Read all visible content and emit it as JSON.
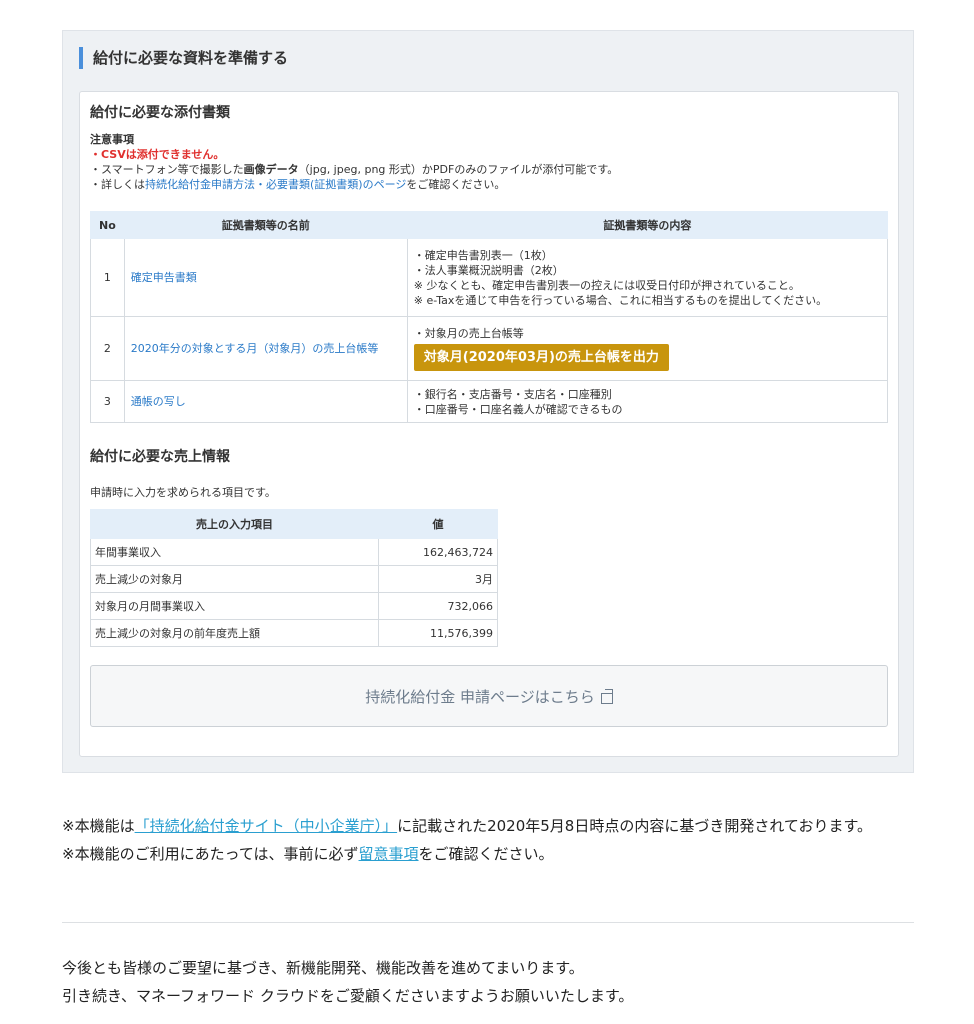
{
  "section": {
    "heading": "給付に必要な資料を準備する"
  },
  "attachments": {
    "title": "給付に必要な添付書類",
    "notes_title": "注意事項",
    "note_csv": "・CSVは添付できません。",
    "note_image_pre": "・スマートフォン等で撮影した",
    "note_image_bold": "画像データ",
    "note_image_post": "（jpg, jpeg, png 形式）かPDFのみのファイルが添付可能です。",
    "note_detail_pre": "・詳しくは",
    "note_detail_link": "持続化給付金申請方法・必要書類(証拠書類)のページ",
    "note_detail_post": "をご確認ください。",
    "table": {
      "headers": [
        "No",
        "証拠書類等の名前",
        "証拠書類等の内容"
      ],
      "rows": [
        {
          "no": "1",
          "name": "確定申告書類",
          "details": [
            "・確定申告書別表一（1枚）",
            "・法人事業概況説明書（2枚）",
            "※ 少なくとも、確定申告書別表一の控えには収受日付印が押されていること。",
            "※ e-Taxを通じて申告を行っている場合、これに相当するものを提出してください。"
          ]
        },
        {
          "no": "2",
          "name": "2020年分の対象とする月（対象月）の売上台帳等",
          "details": [
            "・対象月の売上台帳等"
          ],
          "button": "対象月(2020年03月)の売上台帳を出力"
        },
        {
          "no": "3",
          "name": "通帳の写し",
          "details": [
            "・銀行名・支店番号・支店名・口座種別",
            "・口座番号・口座名義人が確認できるもの"
          ]
        }
      ]
    }
  },
  "sales": {
    "title": "給付に必要な売上情報",
    "note": "申請時に入力を求められる項目です。",
    "headers": [
      "売上の入力項目",
      "値"
    ],
    "rows": [
      {
        "label": "年間事業収入",
        "value": "162,463,724"
      },
      {
        "label": "売上減少の対象月",
        "value": "3月"
      },
      {
        "label": "対象月の月間事業収入",
        "value": "732,066"
      },
      {
        "label": "売上減少の対象月の前年度売上額",
        "value": "11,576,399"
      }
    ]
  },
  "apply_button": "持続化給付金 申請ページはこちら",
  "footer": {
    "line1_pre": "※本機能は",
    "line1_link": "「持続化給付金サイト（中小企業庁）」",
    "line1_post": "に記載された2020年5月8日時点の内容に基づき開発されております。",
    "line2_pre": "※本機能のご利用にあたっては、事前に必ず",
    "line2_link": "留意事項",
    "line2_post": "をご確認ください。"
  },
  "closing": {
    "line1": "今後とも皆様のご要望に基づき、新機能開発、機能改善を進めてまいります。",
    "line2": "引き続き、マネーフォワード クラウドをご愛顧くださいますようお願いいたします。"
  },
  "colors": {
    "accent": "#4a8fdb",
    "export_button": "#c8950d",
    "link": "#2a7ac8",
    "warning": "#e0302e"
  }
}
